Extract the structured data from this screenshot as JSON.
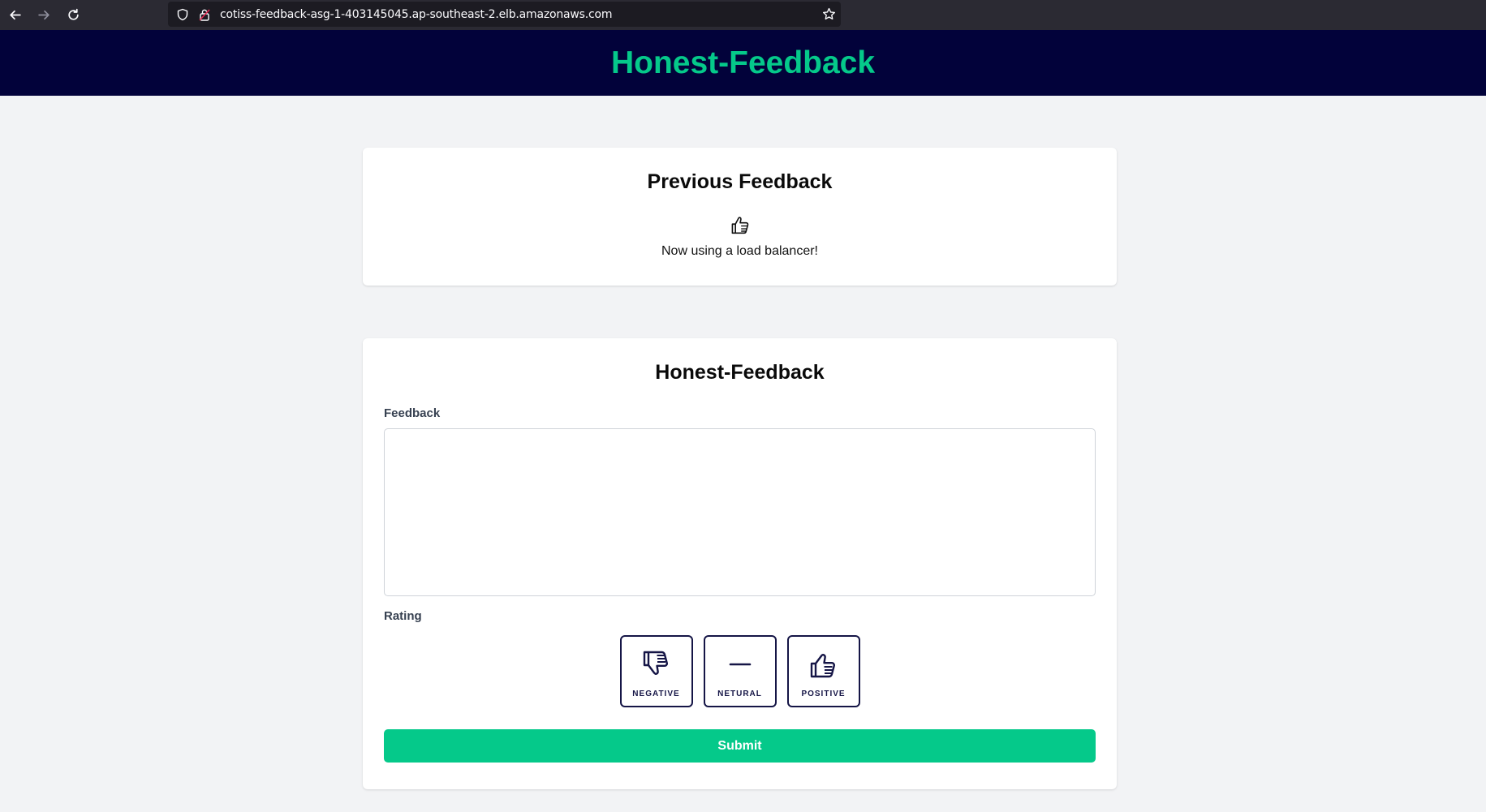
{
  "browser": {
    "url": "cotiss-feedback-asg-1-403145045.ap-southeast-2.elb.amazonaws.com",
    "icons": [
      "back-arrow-icon",
      "forward-arrow-icon",
      "reload-icon",
      "shield-icon",
      "lock-icon",
      "star-icon"
    ]
  },
  "header": {
    "title": "Honest-Feedback",
    "color": "#05c98a",
    "background": "#02023a"
  },
  "previous": {
    "heading": "Previous Feedback",
    "rating_icon": "thumbs-up-icon",
    "text": "Now using a load balancer!"
  },
  "form": {
    "heading": "Honest-Feedback",
    "feedback_label": "Feedback",
    "feedback_value": "",
    "rating_label": "Rating",
    "ratings": [
      {
        "label": "NEGATIVE",
        "icon": "thumbs-down-icon"
      },
      {
        "label": "NETURAL",
        "icon": "minus-icon"
      },
      {
        "label": "POSITIVE",
        "icon": "thumbs-up-icon"
      }
    ],
    "submit_label": "Submit",
    "submit_color": "#05c98a"
  }
}
